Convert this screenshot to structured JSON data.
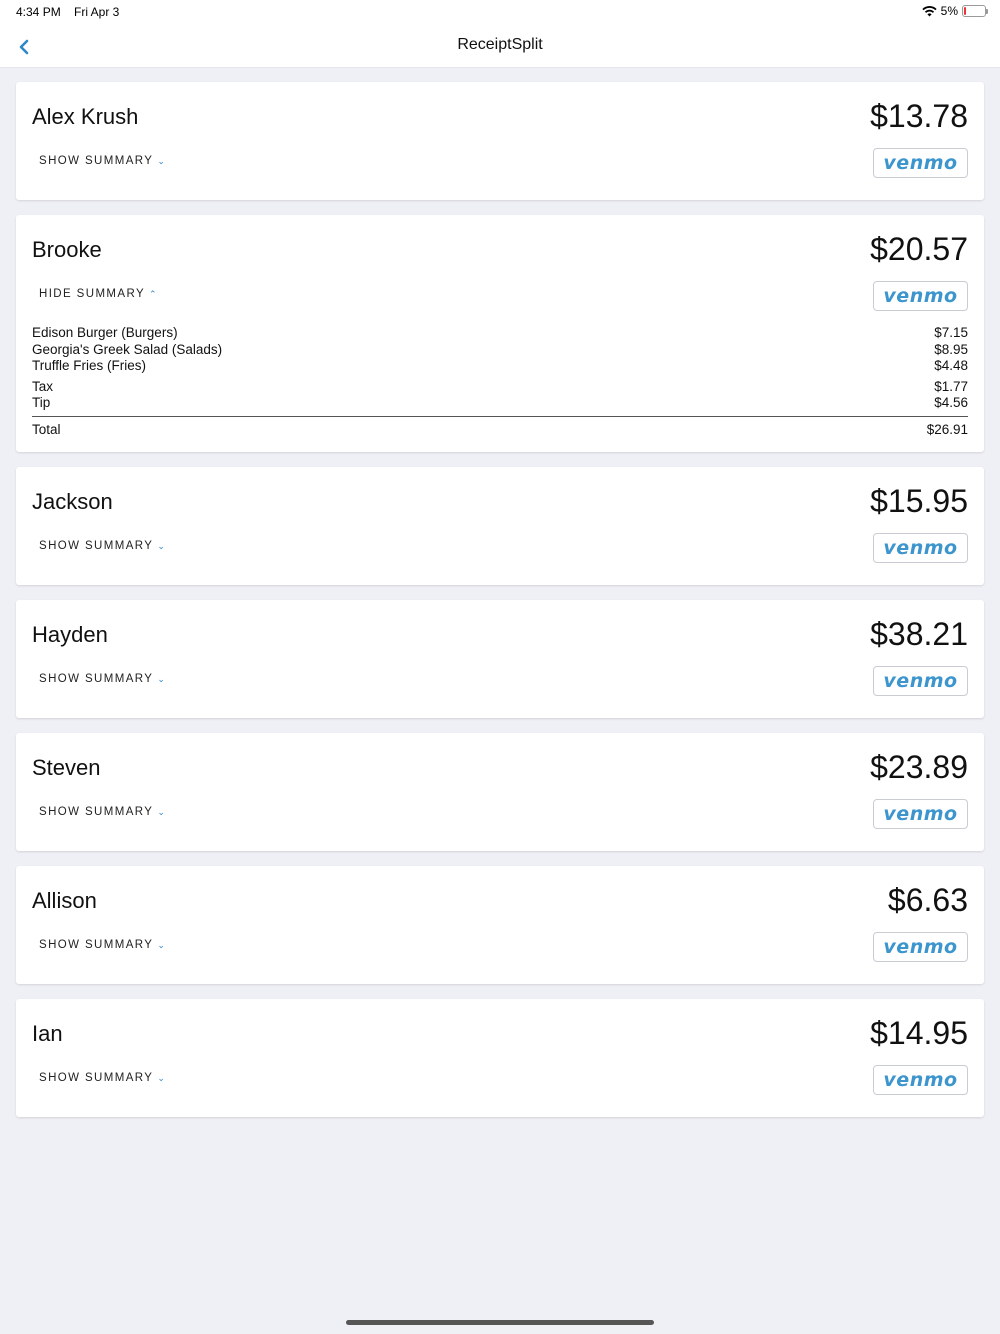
{
  "status_bar": {
    "time": "4:34 PM",
    "date": "Fri Apr 3",
    "battery": "5%"
  },
  "nav": {
    "title": "ReceiptSplit"
  },
  "people": [
    {
      "name": "Alex Krush",
      "amount": "$13.78",
      "toggle": "SHOW SUMMARY",
      "payment": "venmo"
    },
    {
      "name": "Brooke",
      "amount": "$20.57",
      "toggle": "HIDE SUMMARY",
      "payment": "venmo",
      "summary": {
        "items": [
          {
            "label": "Edison Burger (Burgers)",
            "value": "$7.15"
          },
          {
            "label": "Georgia's Greek Salad (Salads)",
            "value": "$8.95"
          },
          {
            "label": "Truffle Fries (Fries)",
            "value": "$4.48"
          }
        ],
        "tax": {
          "label": "Tax",
          "value": "$1.77"
        },
        "tip": {
          "label": "Tip",
          "value": "$4.56"
        },
        "total": {
          "label": "Total",
          "value": "$26.91"
        }
      }
    },
    {
      "name": "Jackson",
      "amount": "$15.95",
      "toggle": "SHOW SUMMARY",
      "payment": "venmo"
    },
    {
      "name": "Hayden",
      "amount": "$38.21",
      "toggle": "SHOW SUMMARY",
      "payment": "venmo"
    },
    {
      "name": "Steven",
      "amount": "$23.89",
      "toggle": "SHOW SUMMARY",
      "payment": "venmo"
    },
    {
      "name": "Allison",
      "amount": "$6.63",
      "toggle": "SHOW SUMMARY",
      "payment": "venmo"
    },
    {
      "name": "Ian",
      "amount": "$14.95",
      "toggle": "SHOW SUMMARY",
      "payment": "venmo"
    }
  ],
  "colors": {
    "accent": "#2f87c8",
    "venmo": "#3d95ce",
    "background": "#eff0f5"
  }
}
